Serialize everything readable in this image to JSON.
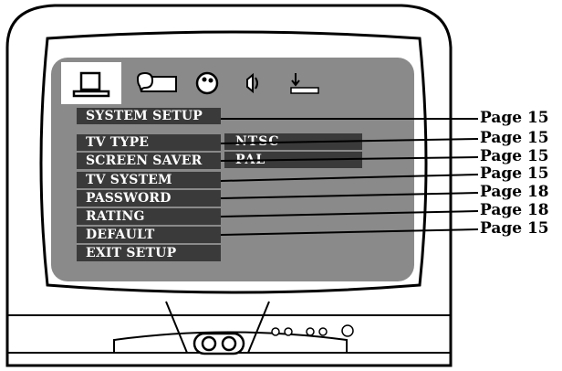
{
  "tabs": [
    {
      "icon": "system-setup-icon",
      "active": true
    },
    {
      "icon": "language-setup-icon",
      "active": false
    },
    {
      "icon": "video-setup-icon",
      "active": false
    },
    {
      "icon": "audio-setup-icon",
      "active": false
    },
    {
      "icon": "download-icon",
      "active": false
    }
  ],
  "menu": {
    "title": "SYSTEM SETUP",
    "items": [
      "TV TYPE",
      "SCREEN  SAVER",
      "TV SYSTEM",
      "PASSWORD",
      "RATING",
      "DEFAULT",
      "EXIT SETUP"
    ]
  },
  "submenu": {
    "options": [
      "NTSC",
      "PAL"
    ]
  },
  "callouts": [
    "Page 15",
    "Page 15",
    "Page 15",
    "Page 15",
    "Page 18",
    "Page 18",
    "Page 15"
  ]
}
